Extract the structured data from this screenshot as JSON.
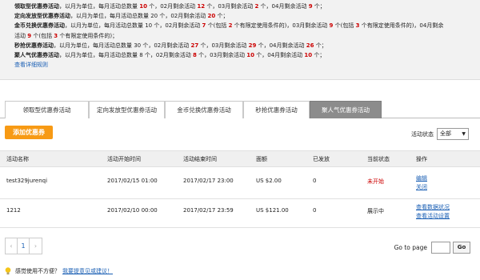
{
  "notice": {
    "lines": [
      {
        "parts": [
          {
            "t": "领取型优惠券活动",
            "s": "b"
          },
          {
            "t": "，以月为单位，每月活动总数量 "
          },
          {
            "t": "10",
            "s": "r"
          },
          {
            "t": " 个，02月剩余活动 "
          },
          {
            "t": "12",
            "s": "r"
          },
          {
            "t": " 个，03月剩余活动 "
          },
          {
            "t": "2",
            "s": "r"
          },
          {
            "t": " 个，04月剩余活动 "
          },
          {
            "t": "9",
            "s": "r"
          },
          {
            "t": " 个；"
          }
        ]
      },
      {
        "parts": [
          {
            "t": "定向发放型优惠券活动",
            "s": "b"
          },
          {
            "t": "，以月为单位，每月活动总数量 20 个，02月剩余活动 "
          },
          {
            "t": "20",
            "s": "r"
          },
          {
            "t": " 个；"
          }
        ]
      },
      {
        "parts": [
          {
            "t": "金币兑换优惠券活动",
            "s": "b"
          },
          {
            "t": "，以月为单位，每月活动总数量 10 个，02月剩余活动 "
          },
          {
            "t": "7",
            "s": "r"
          },
          {
            "t": " 个(包括 "
          },
          {
            "t": "2",
            "s": "r"
          },
          {
            "t": " 个有限定使用条件的)，03月剩余活动 "
          },
          {
            "t": "9",
            "s": "r"
          },
          {
            "t": " 个(包括 "
          },
          {
            "t": "3",
            "s": "r"
          },
          {
            "t": " 个有限定使用条件的)，04月剩余"
          }
        ]
      },
      {
        "parts": [
          {
            "t": "活动 "
          },
          {
            "t": "9",
            "s": "r"
          },
          {
            "t": " 个(包括 "
          },
          {
            "t": "3",
            "s": "r"
          },
          {
            "t": " 个有限定使用条件的)；"
          }
        ]
      },
      {
        "parts": [
          {
            "t": "秒抢优惠券活动",
            "s": "b"
          },
          {
            "t": "，以月为单位，每月活动总数量 30 个，02月剩余活动 "
          },
          {
            "t": "27",
            "s": "r"
          },
          {
            "t": " 个，03月剩余活动 "
          },
          {
            "t": "29",
            "s": "r"
          },
          {
            "t": " 个，04月剩余活动 "
          },
          {
            "t": "26",
            "s": "r"
          },
          {
            "t": " 个；"
          }
        ]
      },
      {
        "parts": [
          {
            "t": "聚人气优惠券活动",
            "s": "b"
          },
          {
            "t": "，以月为单位，每月活动总数量 8 个，02月剩余活动 "
          },
          {
            "t": "8",
            "s": "r"
          },
          {
            "t": " 个，03月剩余活动 "
          },
          {
            "t": "10",
            "s": "r"
          },
          {
            "t": " 个，04月剩余活动 "
          },
          {
            "t": "10",
            "s": "r"
          },
          {
            "t": " 个；"
          }
        ]
      }
    ],
    "detail_link": "查看详细规则"
  },
  "tabs": [
    "领取型优惠券活动",
    "定向发放型优惠券活动",
    "金币兑换优惠券活动",
    "秒抢优惠券活动",
    "聚人气优惠券活动"
  ],
  "active_tab": 4,
  "add_button": "添加优惠券",
  "filter": {
    "label": "活动状态",
    "value": "全部",
    "arrow": "▼"
  },
  "table": {
    "headers": [
      "活动名称",
      "活动开始时间",
      "活动结束时间",
      "面额",
      "已发放",
      "当前状态",
      "操作"
    ],
    "rows": [
      {
        "name": "test329jurenqi",
        "start": "2017/02/15 01:00",
        "end": "2017/02/17 23:00",
        "amount": "US $2.00",
        "issued": "0",
        "status": "未开始",
        "status_color": "#cc0000",
        "actions": [
          "编辑",
          "关闭"
        ]
      },
      {
        "name": "1212",
        "start": "2017/02/10 00:00",
        "end": "2017/02/17 23:59",
        "amount": "US $121.00",
        "issued": "0",
        "status": "展示中",
        "status_color": "#222222",
        "actions": [
          "查看数据状况",
          "查看活动设置"
        ]
      }
    ]
  },
  "pagination": {
    "prev": "‹",
    "page": "1",
    "next": "›"
  },
  "goto": {
    "label": "Go to page",
    "button": "Go"
  },
  "feedback": {
    "text": "感觉使用不方便？",
    "link": "我要提意见或建议！"
  },
  "colors": {
    "accent": "#f79a14",
    "link": "#1a5fb4",
    "highlight": "#cc0000"
  }
}
